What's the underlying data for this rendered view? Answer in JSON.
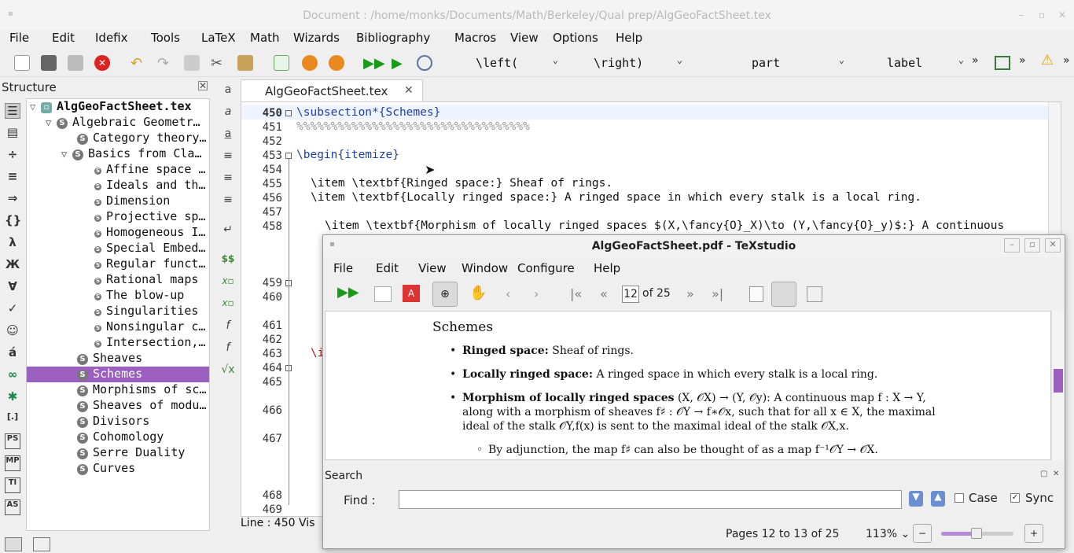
{
  "window": {
    "title": "Document : /home/monks/Documents/Math/Berkeley/Qual prep/AlgGeoFactSheet.tex"
  },
  "menu": [
    "File",
    "Edit",
    "Idefix",
    "Tools",
    "LaTeX",
    "Math",
    "Wizards",
    "Bibliography",
    "Macros",
    "View",
    "Options",
    "Help"
  ],
  "toolbar": {
    "left_paren": "\\left(",
    "right_paren": "\\right)",
    "section": "part",
    "label": "label",
    "more": "»"
  },
  "structure": {
    "title": "Structure",
    "root": "AlgGeoFactSheet.tex",
    "items": [
      {
        "label": "Algebraic Geometr…",
        "level": 1
      },
      {
        "label": "Category theory…",
        "level": 2
      },
      {
        "label": "Basics from Cla…",
        "level": 2
      },
      {
        "label": "Affine space …",
        "level": 3
      },
      {
        "label": "Ideals and th…",
        "level": 3
      },
      {
        "label": "Dimension",
        "level": 3
      },
      {
        "label": "Projective sp…",
        "level": 3
      },
      {
        "label": "Homogeneous I…",
        "level": 3
      },
      {
        "label": "Special Embed…",
        "level": 3
      },
      {
        "label": "Regular funct…",
        "level": 3
      },
      {
        "label": "Rational maps",
        "level": 3
      },
      {
        "label": "The blow-up",
        "level": 3
      },
      {
        "label": "Singularities",
        "level": 3
      },
      {
        "label": "Nonsingular c…",
        "level": 3
      },
      {
        "label": "Intersection,…",
        "level": 3
      },
      {
        "label": "Sheaves",
        "level": 2
      },
      {
        "label": "Schemes",
        "level": 2,
        "selected": true
      },
      {
        "label": "Morphisms of sc…",
        "level": 2
      },
      {
        "label": "Sheaves of modu…",
        "level": 2
      },
      {
        "label": "Divisors",
        "level": 2
      },
      {
        "label": "Cohomology",
        "level": 2
      },
      {
        "label": "Serre Duality",
        "level": 2
      },
      {
        "label": "Curves",
        "level": 2
      }
    ]
  },
  "left_icons": [
    "λ",
    "Ж",
    "∀",
    "✓",
    "☺",
    "á",
    "∞",
    "✱",
    "[.]",
    "PS",
    "MP",
    "TI",
    "AS"
  ],
  "editor": {
    "tab": "AlgGeoFactSheet.tex",
    "lines": [
      {
        "n": "450",
        "text": "\\subsection*{Schemes}"
      },
      {
        "n": "451",
        "text": "%%%%%%%%%%%%%%%%%%%%%%%%%%%%%%%%%%"
      },
      {
        "n": "452",
        "text": ""
      },
      {
        "n": "453",
        "text": "\\begin{itemize}"
      },
      {
        "n": "454",
        "text": ""
      },
      {
        "n": "455",
        "text": "\\item \\textbf{Ringed space:} Sheaf of rings."
      },
      {
        "n": "456",
        "text": "\\item \\textbf{Locally ringed space:} A ringed space in which every stalk is a local ring."
      },
      {
        "n": "457",
        "text": ""
      },
      {
        "n": "458",
        "text": "\\item \\textbf{Morphism of locally ringed spaces $(X,\\fancy{O}_X)\\to (Y,\\fancy{O}_y)$:} A continuous"
      },
      {
        "n": "459",
        "text": ""
      },
      {
        "n": "460",
        "text": ""
      },
      {
        "n": "461",
        "text": ""
      },
      {
        "n": "462",
        "text": ""
      },
      {
        "n": "463",
        "text": "\\i"
      },
      {
        "n": "464",
        "text": ""
      },
      {
        "n": "465",
        "text": ""
      },
      {
        "n": "466",
        "text": ""
      },
      {
        "n": "467",
        "text": ""
      },
      {
        "n": "468",
        "text": ""
      },
      {
        "n": "469",
        "text": ""
      }
    ],
    "status": "Line : 450 Vis"
  },
  "pdf": {
    "title": "AlgGeoFactSheet.pdf - TeXstudio",
    "menu": [
      "File",
      "Edit",
      "View",
      "Window",
      "Configure",
      "Help"
    ],
    "page_current": "12",
    "page_of": "of 25",
    "heading": "Schemes",
    "bullets": [
      {
        "bold": "Ringed space:",
        "text": " Sheaf of rings."
      },
      {
        "bold": "Locally ringed space:",
        "text": " A ringed space in which every stalk is a local ring."
      },
      {
        "bold": "Morphism of locally ringed spaces",
        "text": " (X, 𝒪X) → (Y, 𝒪y): A continuous map f : X → Y,"
      },
      {
        "bold": "",
        "text": "along with a morphism of sheaves f♯ : 𝒪Y → f∗𝒪x, such that for all x ∈ X, the maximal"
      },
      {
        "bold": "",
        "text": "ideal of the stalk 𝒪Y,f(x) is sent to the maximal ideal of the stalk 𝒪X,x."
      }
    ],
    "sub_bullet": "By adjunction, the map f♯ can also be thought of as a map f⁻¹𝒪Y → 𝒪X.",
    "search": {
      "title": "Search",
      "find_label": "Find :",
      "find_value": "",
      "case_label": "Case",
      "case_checked": false,
      "sync_label": "Sync",
      "sync_checked": true
    },
    "status": {
      "pages": "Pages 12 to 13 of 25",
      "zoom": "113%"
    }
  }
}
